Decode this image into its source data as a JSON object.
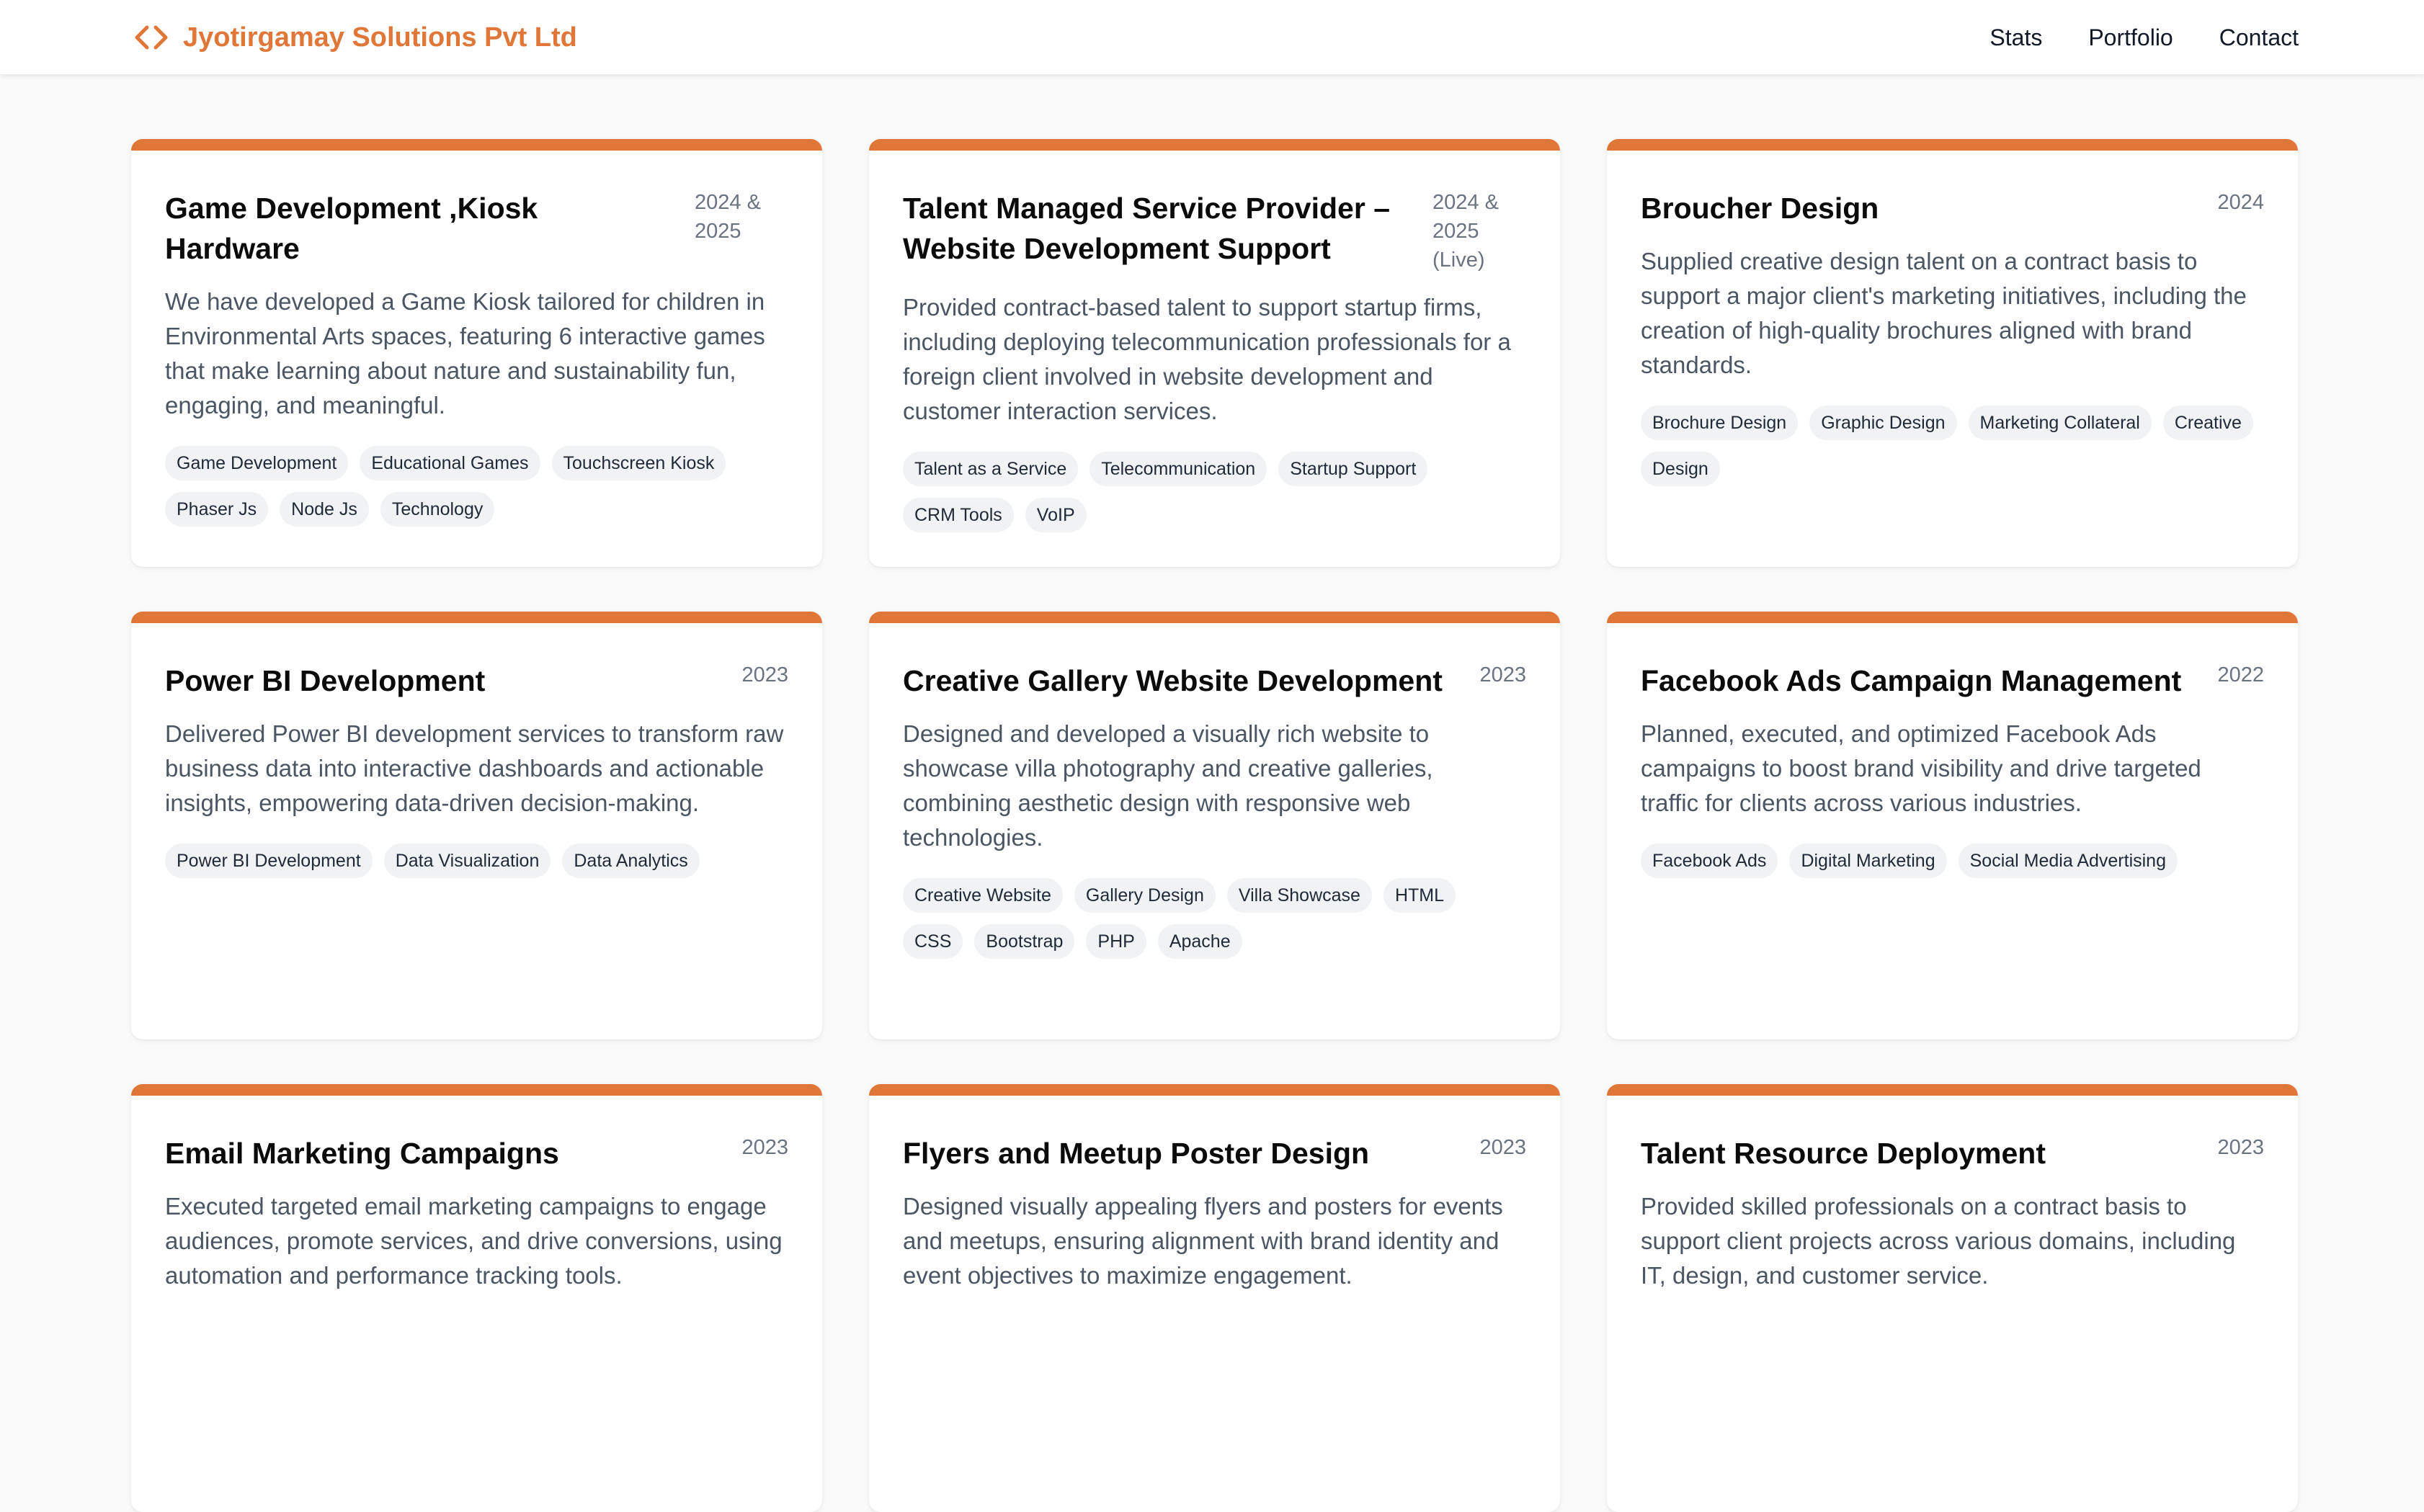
{
  "header": {
    "brand": {
      "name": "Jyotirgamay Solutions Pvt Ltd",
      "icon": "code-brackets-icon",
      "color": "#e07637"
    },
    "nav": [
      "Stats",
      "Portfolio",
      "Contact"
    ]
  },
  "theme": {
    "accent": "#e07637",
    "tag_bg": "#f1f2f4",
    "text_muted": "#4b5563"
  },
  "projects": [
    {
      "title": "Game Development ,Kiosk Hardware",
      "year": "2024 & 2025",
      "description": "We have developed a Game Kiosk tailored for children in Environmental Arts spaces, featuring 6 interactive games that make learning about nature and sustainability fun, engaging, and meaningful.",
      "tags": [
        "Game Development",
        "Educational Games",
        "Touchscreen Kiosk",
        "Phaser Js",
        "Node Js",
        "Technology"
      ]
    },
    {
      "title": "Talent Managed Service Provider – Website Development Support",
      "year": "2024 & 2025 (Live)",
      "description": "Provided contract-based talent to support startup firms, including deploying telecommunication professionals for a foreign client involved in website development and customer interaction services.",
      "tags": [
        "Talent as a Service",
        "Telecommunication",
        "Startup Support",
        "CRM Tools",
        "VoIP"
      ]
    },
    {
      "title": "Broucher Design",
      "year": "2024",
      "description": "Supplied creative design talent on a contract basis to support a major client's marketing initiatives, including the creation of high-quality brochures aligned with brand standards.",
      "tags": [
        "Brochure Design",
        "Graphic Design",
        "Marketing Collateral",
        "Creative",
        "Design"
      ]
    },
    {
      "title": "Power BI Development",
      "year": "2023",
      "description": "Delivered Power BI development services to transform raw business data into interactive dashboards and actionable insights, empowering data-driven decision-making.",
      "tags": [
        "Power BI Development",
        "Data Visualization",
        "Data Analytics"
      ]
    },
    {
      "title": "Creative Gallery Website Development",
      "year": "2023",
      "description": "Designed and developed a visually rich website to showcase villa photography and creative galleries, combining aesthetic design with responsive web technologies.",
      "tags": [
        "Creative Website",
        "Gallery Design",
        "Villa Showcase",
        "HTML",
        "CSS",
        "Bootstrap",
        "PHP",
        "Apache"
      ]
    },
    {
      "title": "Facebook Ads Campaign Management",
      "year": "2022",
      "description": "Planned, executed, and optimized Facebook Ads campaigns to boost brand visibility and drive targeted traffic for clients across various industries.",
      "tags": [
        "Facebook Ads",
        "Digital Marketing",
        "Social Media Advertising"
      ]
    },
    {
      "title": "Email Marketing Campaigns",
      "year": "2023",
      "description": "Executed targeted email marketing campaigns to engage audiences, promote services, and drive conversions, using automation and performance tracking tools.",
      "tags": []
    },
    {
      "title": "Flyers and Meetup Poster Design",
      "year": "2023",
      "description": "Designed visually appealing flyers and posters for events and meetups, ensuring alignment with brand identity and event objectives to maximize engagement.",
      "tags": []
    },
    {
      "title": "Talent Resource Deployment",
      "year": "2023",
      "description": "Provided skilled professionals on a contract basis to support client projects across various domains, including IT, design, and customer service.",
      "tags": []
    }
  ]
}
